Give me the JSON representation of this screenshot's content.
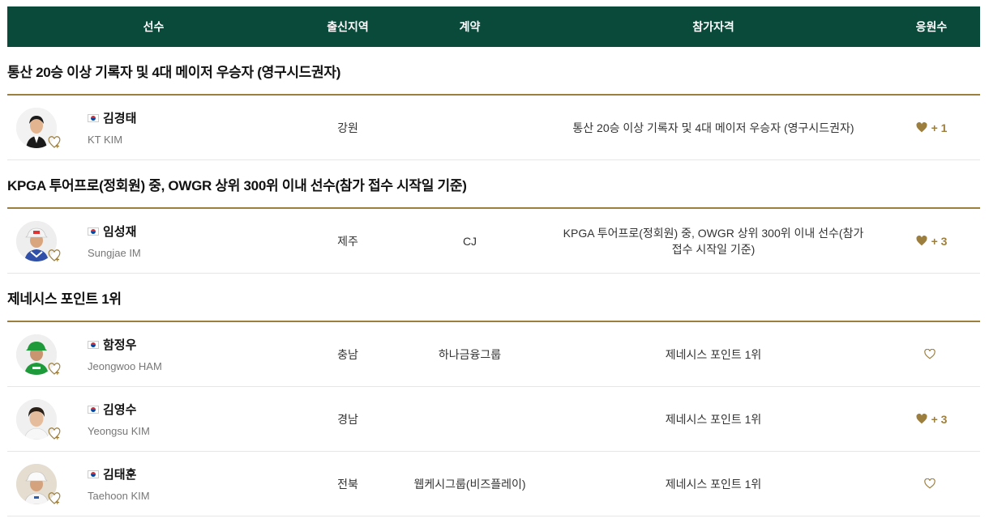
{
  "header": {
    "player": "선수",
    "region": "출신지역",
    "contract": "계약",
    "qualification": "참가자격",
    "fans": "응원수"
  },
  "sections": [
    {
      "title": "통산 20승 이상 기록자 및 4대 메이저 우승자 (영구시드권자)",
      "players": [
        {
          "name_ko": "김경태",
          "name_en": "KT KIM",
          "region": "강원",
          "contract": "",
          "qualification": "통산 20승 이상 기록자 및 4대 메이저 우승자 (영구시드권자)",
          "fans": "+ 1",
          "liked": true
        }
      ]
    },
    {
      "title": "KPGA 투어프로(정회원) 중, OWGR 상위 300위 이내 선수(참가 접수 시작일 기준)",
      "players": [
        {
          "name_ko": "임성재",
          "name_en": "Sungjae IM",
          "region": "제주",
          "contract": "CJ",
          "qualification": "KPGA 투어프로(정회원) 중, OWGR 상위 300위 이내 선수(참가 접수 시작일 기준)",
          "fans": "+ 3",
          "liked": true
        }
      ]
    },
    {
      "title": "제네시스 포인트 1위",
      "players": [
        {
          "name_ko": "함정우",
          "name_en": "Jeongwoo HAM",
          "region": "충남",
          "contract": "하나금융그룹",
          "qualification": "제네시스 포인트 1위",
          "fans": "",
          "liked": false
        },
        {
          "name_ko": "김영수",
          "name_en": "Yeongsu KIM",
          "region": "경남",
          "contract": "",
          "qualification": "제네시스 포인트 1위",
          "fans": "+ 3",
          "liked": true
        },
        {
          "name_ko": "김태훈",
          "name_en": "Taehoon KIM",
          "region": "전북",
          "contract": "웹케시그룹(비즈플레이)",
          "qualification": "제네시스 포인트 1위",
          "fans": "",
          "liked": false
        }
      ]
    }
  ],
  "colors": {
    "header_bg": "#0a4a3a",
    "accent_gold": "#9c7f3e"
  }
}
